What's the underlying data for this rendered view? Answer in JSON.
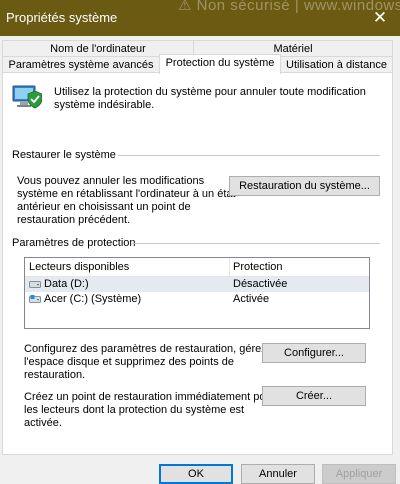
{
  "window": {
    "title": "Propriétés système",
    "background_text": "⚠ Non sécurisé | www.windowshelp.org",
    "close_symbol": "✕",
    "titlebar_color": "#6b5a12"
  },
  "tabs": {
    "row1": [
      {
        "label": "Nom de l'ordinateur"
      },
      {
        "label": "Matériel"
      }
    ],
    "row2": [
      {
        "label": "Paramètres système avancés"
      },
      {
        "label": "Protection du système",
        "active": true
      },
      {
        "label": "Utilisation à distance"
      }
    ]
  },
  "intro": {
    "icon": "system-protection-icon",
    "text_line1": "Utilisez la protection du système pour annuler toute modification",
    "text_line2": "système indésirable."
  },
  "restore": {
    "section_label": "Restaurer le système",
    "desc_lines": [
      "Vous pouvez annuler les modifications",
      "système en rétablissant l'ordinateur à un état",
      "antérieur en choisissant un point de",
      "restauration précédent."
    ],
    "button": "Restauration du système..."
  },
  "protection": {
    "section_label": "Paramètres de protection",
    "columns": [
      "Lecteurs disponibles",
      "Protection"
    ],
    "drives": [
      {
        "name": "Data (D:)",
        "status": "Désactivée",
        "icon": "drive-icon",
        "selected": true
      },
      {
        "name": "Acer (C:) (Système)",
        "status": "Activée",
        "icon": "system-drive-icon",
        "selected": false
      }
    ],
    "configure_desc": [
      "Configurez des paramètres de restauration, gérez",
      "l'espace disque et supprimez des points de",
      "restauration."
    ],
    "configure_button": "Configurer...",
    "create_desc": [
      "Créez un point de restauration immédiatement pour",
      "les lecteurs dont la protection du système est",
      "activée."
    ],
    "create_button": "Créer..."
  },
  "footer": {
    "ok": "OK",
    "cancel": "Annuler",
    "apply": "Appliquer"
  }
}
